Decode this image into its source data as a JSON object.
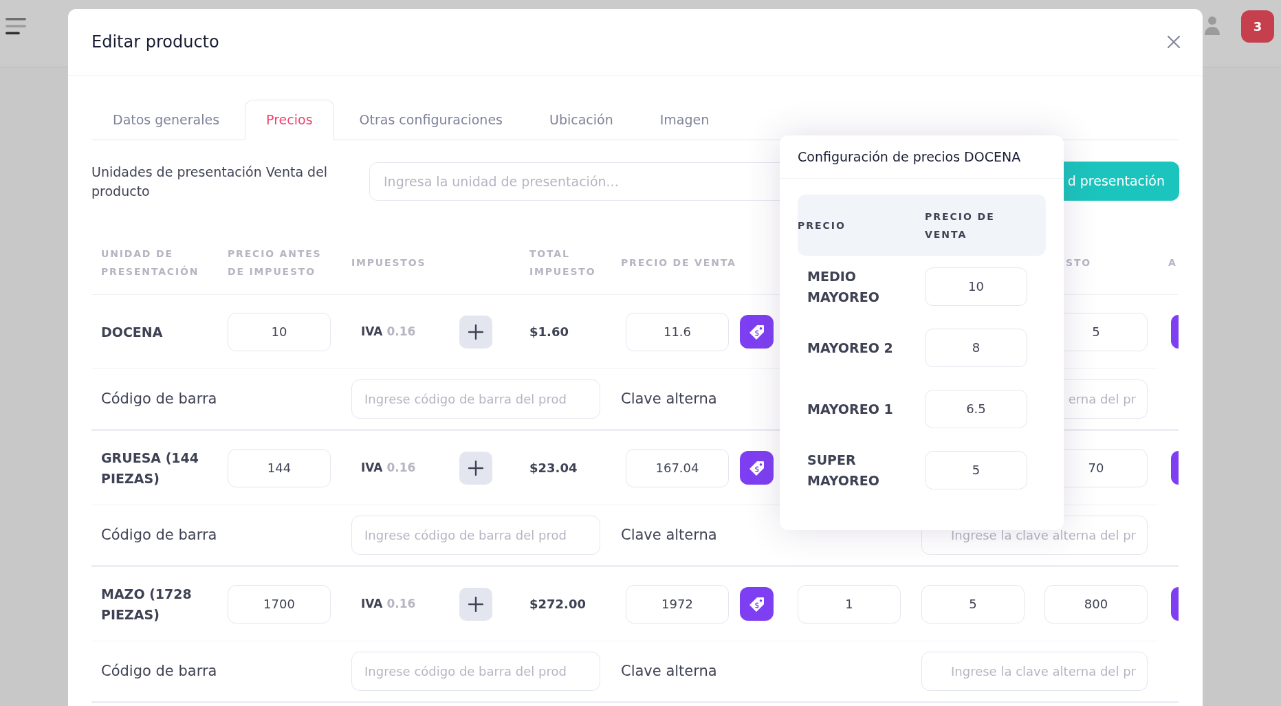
{
  "app_bar": {
    "notification_count": "3"
  },
  "dialog": {
    "title": "Editar producto"
  },
  "tabs": [
    {
      "label": "Datos generales",
      "selected": false
    },
    {
      "label": "Precios",
      "selected": true
    },
    {
      "label": "Otras configuraciones",
      "selected": false
    },
    {
      "label": "Ubicación",
      "selected": false
    },
    {
      "label": "Imagen",
      "selected": false
    }
  ],
  "presentation_units": {
    "label": "Unidades de presentación Venta del producto",
    "placeholder": "Ingresa la unidad de presentación...",
    "button": "d presentación"
  },
  "table": {
    "columns": [
      "UNIDAD DE PRESENTACIÓN",
      "PRECIO ANTES DE IMPUESTO",
      "IMPUESTOS",
      "TOTAL IMPUESTO",
      "PRECIO DE VENTA",
      "STO",
      "A"
    ],
    "rows": [
      {
        "unit": "DOCENA",
        "price_before_tax": "10",
        "tax": {
          "name": "IVA",
          "rate": "0.16"
        },
        "total_tax": "$1.60",
        "sale_price": "11.6",
        "column_8": "5",
        "barcode_label": "Código de barra",
        "barcode_placeholder": "Ingrese código de barra del prod",
        "alt_key_label": "Clave alterna",
        "alt_key_placeholder": "erna del pr"
      },
      {
        "unit": "GRUESA (144 PIEZAS)",
        "price_before_tax": "144",
        "tax": {
          "name": "IVA",
          "rate": "0.16"
        },
        "total_tax": "$23.04",
        "sale_price": "167.04",
        "column_8": "70",
        "barcode_label": "Código de barra",
        "barcode_placeholder": "Ingrese código de barra del prod",
        "alt_key_label": "Clave alterna",
        "alt_key_placeholder": "Ingrese la clave alterna del pr"
      },
      {
        "unit": "MAZO (1728 PIEZAS)",
        "price_before_tax": "1700",
        "tax": {
          "name": "IVA",
          "rate": "0.16"
        },
        "total_tax": "$272.00",
        "sale_price": "1972",
        "column_6": "1",
        "column_7": "5",
        "column_8": "800",
        "barcode_label": "Código de barra",
        "barcode_placeholder": "Ingrese código de barra del prod",
        "alt_key_label": "Clave alterna",
        "alt_key_placeholder": "Ingrese la clave alterna del pr"
      }
    ]
  },
  "price_popover": {
    "title": "Configuración de precios DOCENA",
    "columns": [
      "PRECIO",
      "PRECIO DE VENTA"
    ],
    "rows": [
      {
        "tier": "MEDIO MAYOREO",
        "price": "10"
      },
      {
        "tier": "MAYOREO 2",
        "price": "8"
      },
      {
        "tier": "MAYOREO 1",
        "price": "6.5"
      },
      {
        "tier": "SUPER MAYOREO",
        "price": "5"
      }
    ]
  }
}
